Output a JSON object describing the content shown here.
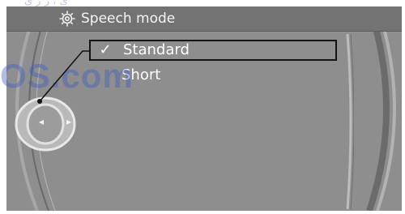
{
  "window": {
    "title": "Speech mode",
    "title_icon": "gear-icon"
  },
  "menu": {
    "items": [
      {
        "label": "Standard",
        "checked": true,
        "check_glyph": "✓"
      },
      {
        "label": "Short",
        "checked": false,
        "check_glyph": ""
      }
    ]
  },
  "controller": {
    "icon": "idrive-controller-icon",
    "left_arrow": "◂",
    "right_arrow": "▸"
  },
  "watermark": {
    "top_text": "ی  ،  ر ر ی",
    "main_text": "OS.com"
  },
  "colors": {
    "screen_bg": "#8e8e8e",
    "titlebar_bg": "#737373",
    "text": "#ffffff",
    "highlight_border": "#141414"
  }
}
